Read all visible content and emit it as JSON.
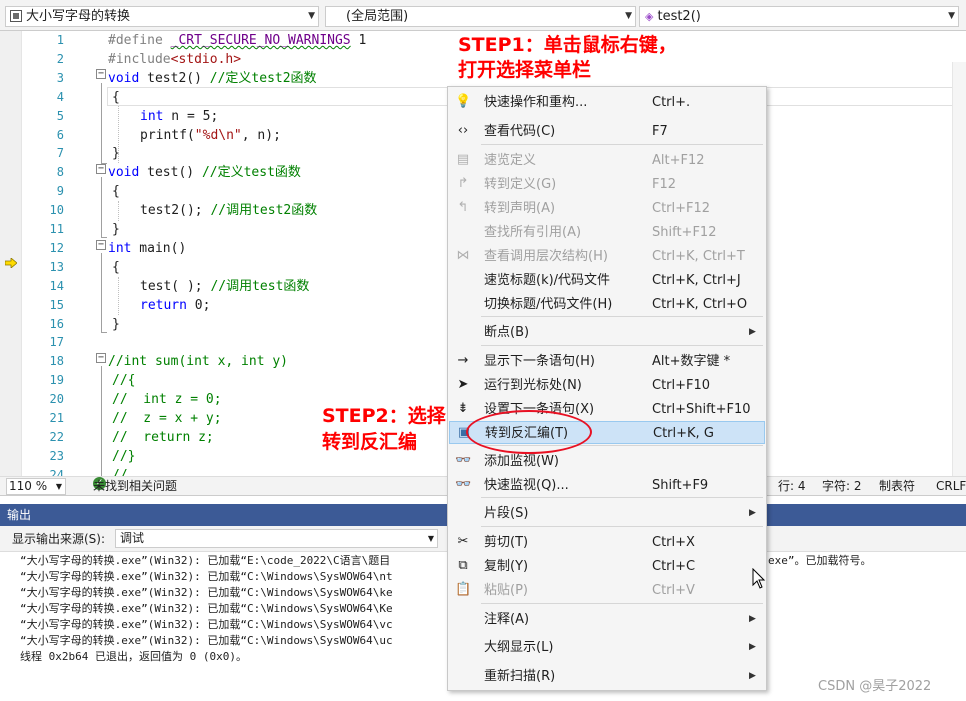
{
  "navbar": {
    "project": "大小写字母的转换",
    "scope": "(全局范围)",
    "function": "test2()"
  },
  "code_lines": [
    {
      "n": "1",
      "segs": [
        {
          "t": "#define ",
          "c": "pp"
        },
        {
          "t": "_CRT_SECURE_NO_WARNINGS",
          "c": "macro sq"
        },
        {
          "t": " 1",
          "c": ""
        }
      ]
    },
    {
      "n": "2",
      "segs": [
        {
          "t": "#include",
          "c": "pp"
        },
        {
          "t": "<stdio.h>",
          "c": "str"
        }
      ]
    },
    {
      "n": "3",
      "segs": [
        {
          "t": "void",
          "c": "kw"
        },
        {
          "t": " test2() ",
          "c": ""
        },
        {
          "t": "//定义test2函数",
          "c": "cm"
        }
      ]
    },
    {
      "n": "4",
      "segs": [
        {
          "t": "{",
          "c": ""
        }
      ]
    },
    {
      "n": "5",
      "segs": [
        {
          "t": "int",
          "c": "kw"
        },
        {
          "t": " n = 5;",
          "c": ""
        }
      ]
    },
    {
      "n": "6",
      "segs": [
        {
          "t": "printf(",
          "c": ""
        },
        {
          "t": "\"%d\\n\"",
          "c": "str"
        },
        {
          "t": ", n);",
          "c": ""
        }
      ]
    },
    {
      "n": "7",
      "segs": [
        {
          "t": "}",
          "c": ""
        }
      ]
    },
    {
      "n": "8",
      "segs": [
        {
          "t": "void",
          "c": "kw"
        },
        {
          "t": " test() ",
          "c": ""
        },
        {
          "t": "//定义test函数",
          "c": "cm"
        }
      ]
    },
    {
      "n": "9",
      "segs": [
        {
          "t": "{",
          "c": ""
        }
      ]
    },
    {
      "n": "10",
      "segs": [
        {
          "t": "test2(); ",
          "c": ""
        },
        {
          "t": "//调用test2函数",
          "c": "cm"
        }
      ]
    },
    {
      "n": "11",
      "segs": [
        {
          "t": "}",
          "c": ""
        }
      ]
    },
    {
      "n": "12",
      "segs": [
        {
          "t": "int",
          "c": "kw"
        },
        {
          "t": " main()",
          "c": ""
        }
      ]
    },
    {
      "n": "13",
      "segs": [
        {
          "t": "{",
          "c": ""
        }
      ]
    },
    {
      "n": "14",
      "segs": [
        {
          "t": "test( ); ",
          "c": ""
        },
        {
          "t": "//调用test函数",
          "c": "cm"
        }
      ]
    },
    {
      "n": "15",
      "segs": [
        {
          "t": "return",
          "c": "kw"
        },
        {
          "t": " 0;",
          "c": ""
        }
      ]
    },
    {
      "n": "16",
      "segs": [
        {
          "t": "}",
          "c": ""
        }
      ]
    },
    {
      "n": "17",
      "segs": []
    },
    {
      "n": "18",
      "segs": [
        {
          "t": "//int sum(int x, int y)",
          "c": "cm"
        }
      ]
    },
    {
      "n": "19",
      "segs": [
        {
          "t": "//{",
          "c": "cm"
        }
      ]
    },
    {
      "n": "20",
      "segs": [
        {
          "t": "//  int z = 0;",
          "c": "cm"
        }
      ]
    },
    {
      "n": "21",
      "segs": [
        {
          "t": "//  z = x + y;",
          "c": "cm"
        }
      ]
    },
    {
      "n": "22",
      "segs": [
        {
          "t": "//  return z;",
          "c": "cm"
        }
      ]
    },
    {
      "n": "23",
      "segs": [
        {
          "t": "//}",
          "c": "cm"
        }
      ]
    },
    {
      "n": "24",
      "segs": [
        {
          "t": "//",
          "c": "cm"
        }
      ]
    }
  ],
  "annotations": {
    "step1_line1": "STEP1：单击鼠标右键，",
    "step1_line2": "打开选择菜单栏",
    "step2_line1": "STEP2：选择",
    "step2_line2": "转到反汇编"
  },
  "editor_status": {
    "zoom": "110 %",
    "issues": "未找到相关问题",
    "line": "行: 4",
    "col": "字符: 2",
    "tabs": "制表符",
    "eol": "CRLF"
  },
  "output": {
    "title": "输出",
    "source_label": "显示输出来源(S):",
    "source_value": "调试",
    "lines": [
      "“大小写字母的转换.exe”(Win32): 已加载“E:\\code_2022\\C语言\\题目",
      "“大小写字母的转换.exe”(Win32): 已加载“C:\\Windows\\SysWOW64\\nt",
      "“大小写字母的转换.exe”(Win32): 已加载“C:\\Windows\\SysWOW64\\ke",
      "“大小写字母的转换.exe”(Win32): 已加载“C:\\Windows\\SysWOW64\\Ke",
      "“大小写字母的转换.exe”(Win32): 已加载“C:\\Windows\\SysWOW64\\vc",
      "“大小写字母的转换.exe”(Win32): 已加载“C:\\Windows\\SysWOW64\\uc",
      "线程 0x2b64 已退出，返回值为 0 (0x0)。"
    ],
    "line1_tail": "exe”。已加载符号。"
  },
  "menu": {
    "items": [
      {
        "icon": "💡",
        "iconName": "lightbulb-icon",
        "label": "快速操作和重构...",
        "key": "Ctrl+.",
        "disabled": false,
        "sub": false,
        "highlight": false
      },
      {
        "icon": "‹›",
        "iconName": "code-view-icon",
        "label": "查看代码(C)",
        "key": "F7",
        "disabled": false,
        "sub": false,
        "highlight": false
      },
      {
        "icon": "▤",
        "iconName": "peek-definition-icon",
        "label": "速览定义",
        "key": "Alt+F12",
        "disabled": true,
        "sub": false,
        "highlight": false
      },
      {
        "icon": "↱",
        "iconName": "go-to-definition-icon",
        "label": "转到定义(G)",
        "key": "F12",
        "disabled": true,
        "sub": false,
        "highlight": false
      },
      {
        "icon": "↰",
        "iconName": "go-to-declaration-icon",
        "label": "转到声明(A)",
        "key": "Ctrl+F12",
        "disabled": true,
        "sub": false,
        "highlight": false
      },
      {
        "icon": "",
        "iconName": "",
        "label": "查找所有引用(A)",
        "key": "Shift+F12",
        "disabled": true,
        "sub": false,
        "highlight": false
      },
      {
        "icon": "⋈",
        "iconName": "call-hierarchy-icon",
        "label": "查看调用层次结构(H)",
        "key": "Ctrl+K, Ctrl+T",
        "disabled": true,
        "sub": false,
        "highlight": false
      },
      {
        "icon": "",
        "iconName": "",
        "label": "速览标题(k)/代码文件",
        "key": "Ctrl+K, Ctrl+J",
        "disabled": false,
        "sub": false,
        "highlight": false
      },
      {
        "icon": "",
        "iconName": "",
        "label": "切换标题/代码文件(H)",
        "key": "Ctrl+K, Ctrl+O",
        "disabled": false,
        "sub": false,
        "highlight": false
      },
      {
        "icon": "",
        "iconName": "",
        "label": "断点(B)",
        "key": "",
        "disabled": false,
        "sub": true,
        "highlight": false
      },
      {
        "icon": "→",
        "iconName": "show-next-statement-icon",
        "label": "显示下一条语句(H)",
        "key": "Alt+数字键 *",
        "disabled": false,
        "sub": false,
        "highlight": false
      },
      {
        "icon": "➤",
        "iconName": "run-to-cursor-icon",
        "label": "运行到光标处(N)",
        "key": "Ctrl+F10",
        "disabled": false,
        "sub": false,
        "highlight": false
      },
      {
        "icon": "⇟",
        "iconName": "set-next-statement-icon",
        "label": "设置下一条语句(X)",
        "key": "Ctrl+Shift+F10",
        "disabled": false,
        "sub": false,
        "highlight": false
      },
      {
        "icon": "▣",
        "iconName": "disassembly-icon",
        "label": "转到反汇编(T)",
        "key": "Ctrl+K, G",
        "disabled": false,
        "sub": false,
        "highlight": true
      },
      {
        "icon": "👓",
        "iconName": "add-watch-icon",
        "label": "添加监视(W)",
        "key": "",
        "disabled": false,
        "sub": false,
        "highlight": false
      },
      {
        "icon": "👓",
        "iconName": "quick-watch-icon",
        "label": "快速监视(Q)...",
        "key": "Shift+F9",
        "disabled": false,
        "sub": false,
        "highlight": false
      },
      {
        "icon": "",
        "iconName": "",
        "label": "片段(S)",
        "key": "",
        "disabled": false,
        "sub": true,
        "highlight": false
      },
      {
        "icon": "✂",
        "iconName": "cut-icon",
        "label": "剪切(T)",
        "key": "Ctrl+X",
        "disabled": false,
        "sub": false,
        "highlight": false
      },
      {
        "icon": "⧉",
        "iconName": "copy-icon",
        "label": "复制(Y)",
        "key": "Ctrl+C",
        "disabled": false,
        "sub": false,
        "highlight": false
      },
      {
        "icon": "📋",
        "iconName": "paste-icon",
        "label": "粘贴(P)",
        "key": "Ctrl+V",
        "disabled": true,
        "sub": false,
        "highlight": false
      },
      {
        "icon": "",
        "iconName": "",
        "label": "注释(A)",
        "key": "",
        "disabled": false,
        "sub": true,
        "highlight": false
      },
      {
        "icon": "",
        "iconName": "",
        "label": "大纲显示(L)",
        "key": "",
        "disabled": false,
        "sub": true,
        "highlight": false
      },
      {
        "icon": "",
        "iconName": "",
        "label": "重新扫描(R)",
        "key": "",
        "disabled": false,
        "sub": true,
        "highlight": false
      }
    ]
  },
  "watermark": "CSDN @昊子2022",
  "colors": {
    "annotation": "#ff0000",
    "highlight_bg": "#cde3f7",
    "output_title_bg": "#3c5a96",
    "status_ok": "#388a34"
  }
}
